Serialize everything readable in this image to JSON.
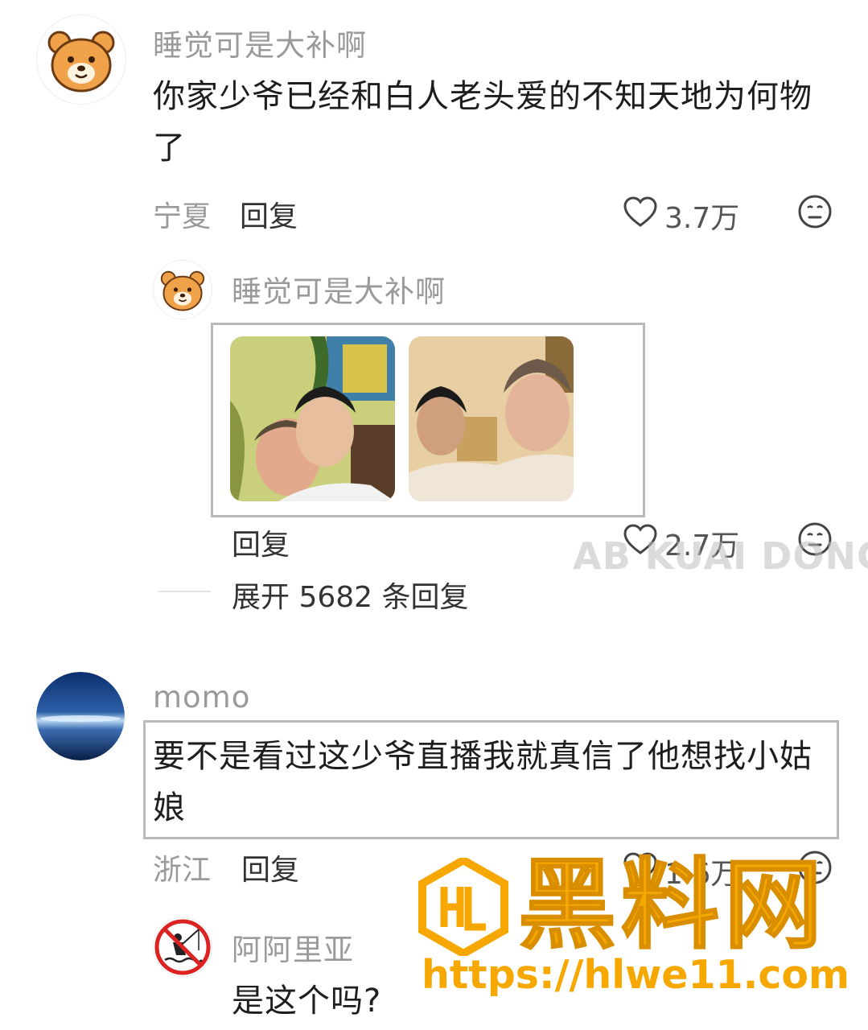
{
  "comments": [
    {
      "user": "睡觉可是大补啊",
      "text": "你家少爷已经和白人老头爱的不知天地为何物了",
      "location": "宁夏",
      "reply_label": "回复",
      "likes": "3.7万",
      "avatar_icon": "bear-face-icon",
      "replies": [
        {
          "user": "睡觉可是大补啊",
          "reply_label": "回复",
          "likes": "2.7万",
          "avatar_icon": "bear-face-icon"
        }
      ],
      "expand_label": "展开 5682 条回复"
    },
    {
      "user": "momo",
      "text": "要不是看过这少爷直播我就真信了他想找小姑娘",
      "location": "浙江",
      "reply_label": "回复",
      "likes": "1.6万",
      "avatar_icon": "sky-horizon-avatar",
      "replies": [
        {
          "user": "阿阿里亚",
          "text": "是这个吗?",
          "avatar_icon": "no-fishing-sign-icon"
        }
      ]
    }
  ],
  "watermark": {
    "text": "AB KUAI DONG",
    "brand": "黑料网",
    "url": "https://hlwe11.com"
  },
  "colors": {
    "meta_gray": "#9a9a9a",
    "highlight_box": "#b9b9b9",
    "watermark_orange": "#f6a800",
    "bear_orange": "#f0a24a"
  }
}
